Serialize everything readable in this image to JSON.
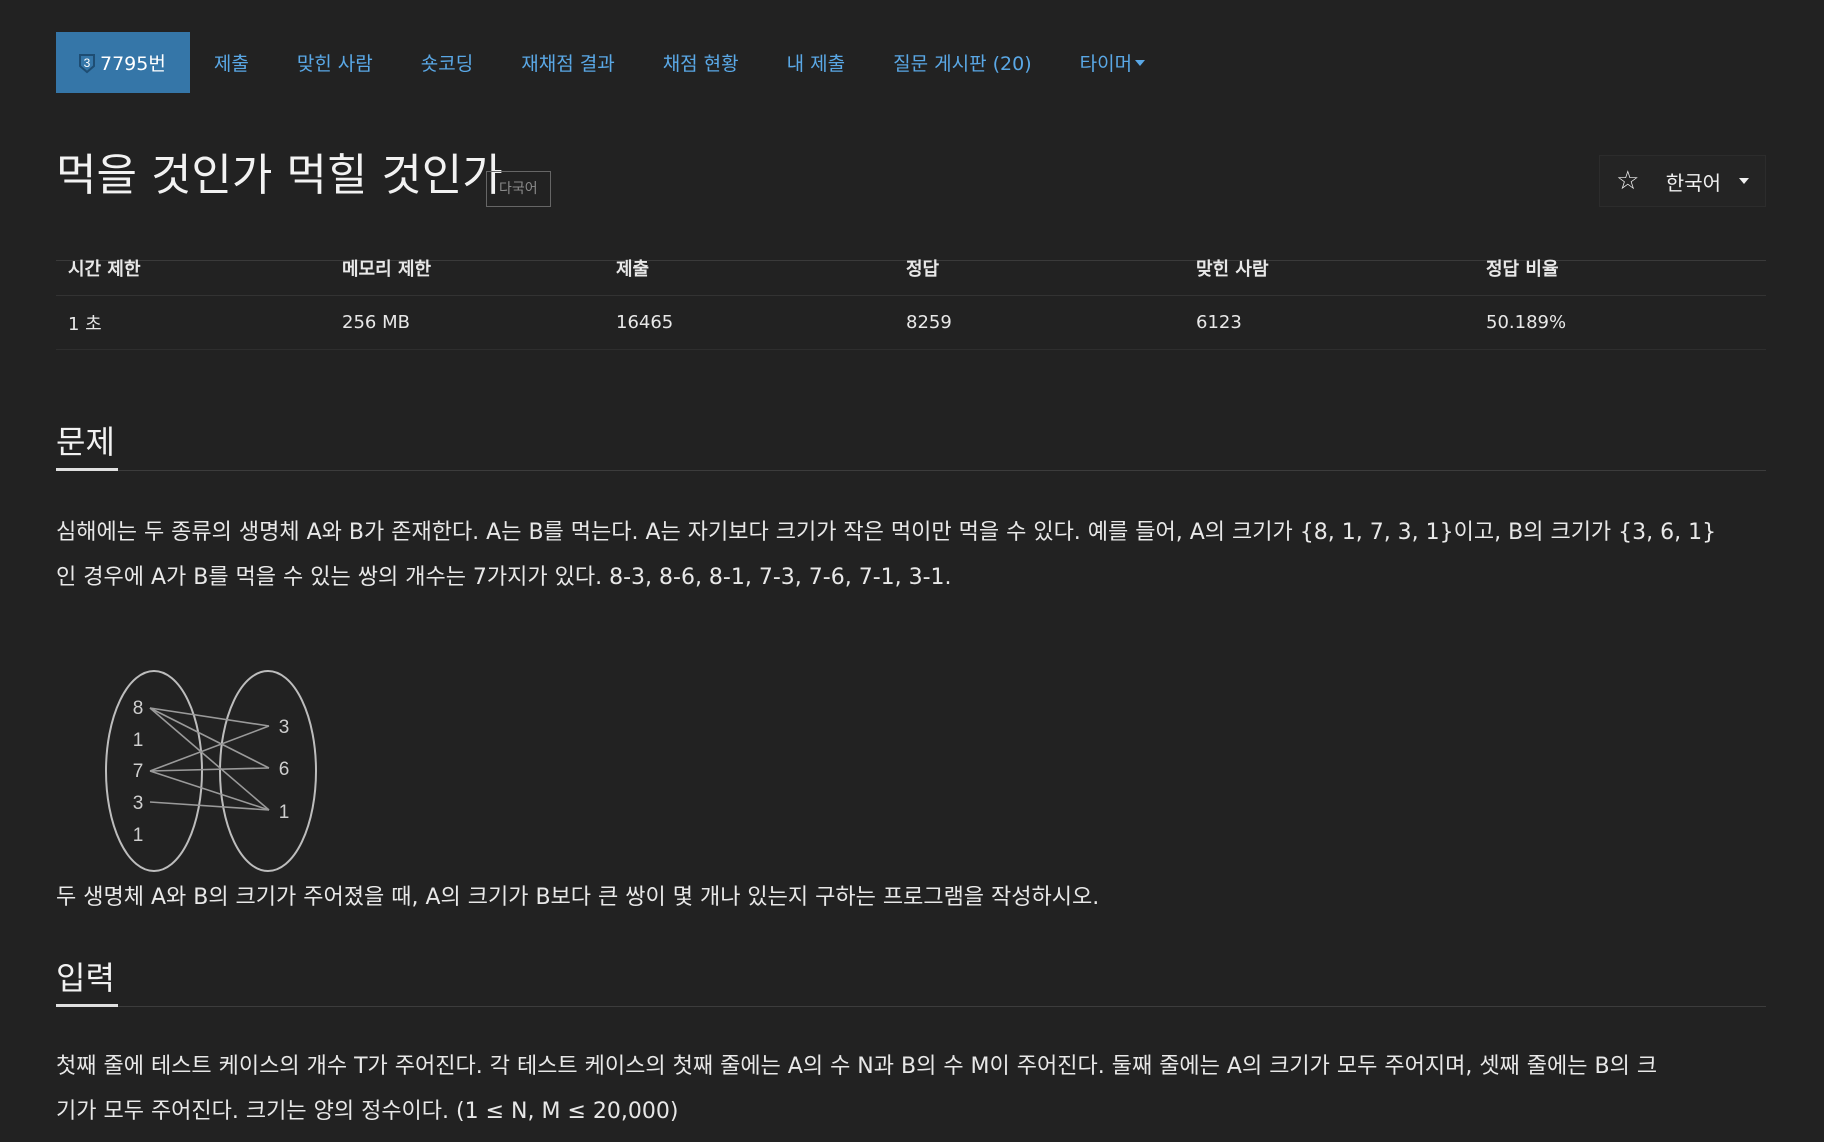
{
  "tabs": {
    "problem_number": "7795번",
    "tier_badge_text": "3",
    "items": [
      "제출",
      "맞힌 사람",
      "숏코딩",
      "재채점 결과",
      "채점 현황",
      "내 제출",
      "질문 게시판 (20)",
      "타이머"
    ]
  },
  "problem": {
    "title": "먹을 것인가 먹힐 것인가",
    "lang_label": "다국어",
    "language_select": "한국어"
  },
  "info": {
    "headers": [
      "시간 제한",
      "메모리 제한",
      "제출",
      "정답",
      "맞힌 사람",
      "정답 비율"
    ],
    "values": [
      "1 초",
      "256 MB",
      "16465",
      "8259",
      "6123",
      "50.189%"
    ]
  },
  "sections": {
    "problem_title": "문제",
    "problem_para1_line1": "심해에는 두 종류의 생명체 A와 B가 존재한다. A는 B를 먹는다. A는 자기보다 크기가 작은 먹이만 먹을 수 있다. 예를 들어, A의 크기가 {8, 1, 7, 3, 1}이고, B의 크기가 {3, 6, 1}",
    "problem_para1_line2": "인 경우에 A가 B를 먹을 수 있는 쌍의 개수는 7가지가 있다. 8-3, 8-6, 8-1, 7-3, 7-6, 7-1, 3-1.",
    "problem_para2": "두 생명체 A와 B의 크기가 주어졌을 때, A의 크기가 B보다 큰 쌍이 몇 개나 있는지 구하는 프로그램을 작성하시오.",
    "input_title": "입력",
    "input_para_line1": "첫째 줄에 테스트 케이스의 개수 T가 주어진다. 각 테스트 케이스의 첫째 줄에는 A의 수 N과 B의 수 M이 주어진다. 둘째 줄에는 A의 크기가 모두 주어지며, 셋째 줄에는 B의 크",
    "input_para_line2": "기가 모두 주어진다. 크기는 양의 정수이다. (1 ≤ N, M ≤ 20,000)"
  },
  "figure": {
    "set_a": [
      "8",
      "1",
      "7",
      "3",
      "1"
    ],
    "set_b": [
      "3",
      "6",
      "1"
    ]
  }
}
